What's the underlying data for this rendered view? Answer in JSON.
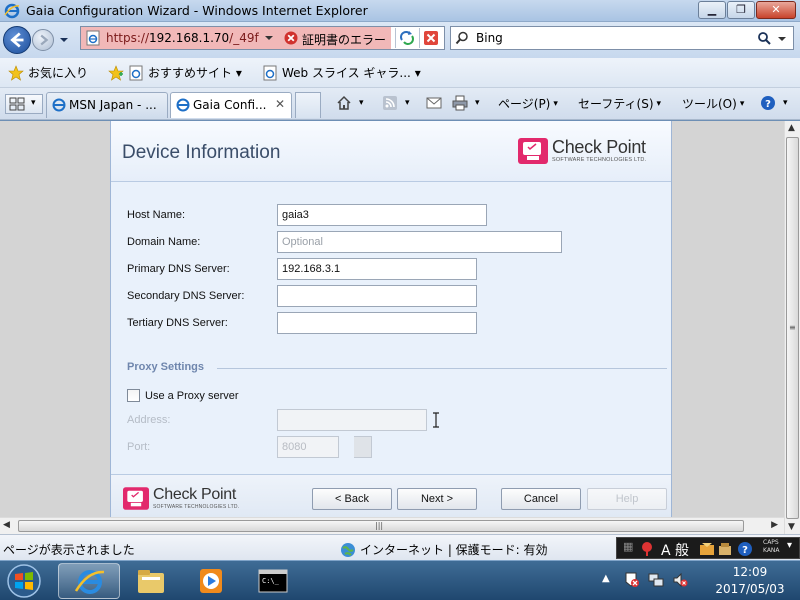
{
  "window": {
    "title": "Gaia Configuration Wizard - Windows Internet Explorer",
    "minimize_glyph": "▁",
    "maximize_glyph": "❐",
    "close_glyph": "✕"
  },
  "address_bar": {
    "url_prefix": "https://",
    "url_host": "192.168.1.70",
    "url_suffix": "/_49f",
    "cert_error": "証明書のエラー"
  },
  "search": {
    "provider": "Bing"
  },
  "favorites_bar": {
    "favorites_label": "お気に入り",
    "suggested_sites": "おすすめサイト ▾",
    "web_slice_gallery": "Web スライス ギャラ... ▾"
  },
  "tabs": {
    "quick_tabs_arrow": "▾",
    "items": [
      {
        "label": "MSN Japan - ..."
      },
      {
        "label": "Gaia Confi..."
      }
    ],
    "close_glyph": "✕"
  },
  "command_bar": {
    "page": "ページ(P)",
    "safety": "セーフティ(S)",
    "tools": "ツール(O)"
  },
  "wizard": {
    "title": "Device Information",
    "logo_name": "Check Point",
    "logo_sub": "SOFTWARE TECHNOLOGIES LTD.",
    "fields": {
      "host_name": {
        "label": "Host Name:",
        "value": "gaia3"
      },
      "domain_name": {
        "label": "Domain Name:",
        "placeholder": "Optional"
      },
      "primary_dns": {
        "label": "Primary DNS Server:",
        "value": "192.168.3.1"
      },
      "secondary_dns": {
        "label": "Secondary DNS Server:",
        "value": ""
      },
      "tertiary_dns": {
        "label": "Tertiary DNS Server:",
        "value": ""
      }
    },
    "proxy": {
      "section_title": "Proxy Settings",
      "use_proxy_label": "Use a Proxy server",
      "use_proxy_checked": false,
      "address_label": "Address:",
      "port_label": "Port:",
      "port_value": "8080"
    },
    "buttons": {
      "back": "< Back",
      "next": "Next >",
      "cancel": "Cancel",
      "help": "Help"
    }
  },
  "scrollbar": {
    "grip": "|||"
  },
  "status_bar": {
    "text": "ページが表示されました",
    "zone": "インターネット | 保護モード: 有効"
  },
  "language_bar": {
    "mode": "A 般",
    "help_glyph": "?",
    "caps": "CAPS",
    "kana": "KANA"
  },
  "taskbar": {
    "time": "12:09",
    "date": "2017/05/03"
  },
  "colors": {
    "cert_error_bg": "#f1b8b8",
    "wizard_title": "#3a4d69",
    "proxy_section": "#6f86ad",
    "checkpoint_logo": "#e2296c"
  }
}
